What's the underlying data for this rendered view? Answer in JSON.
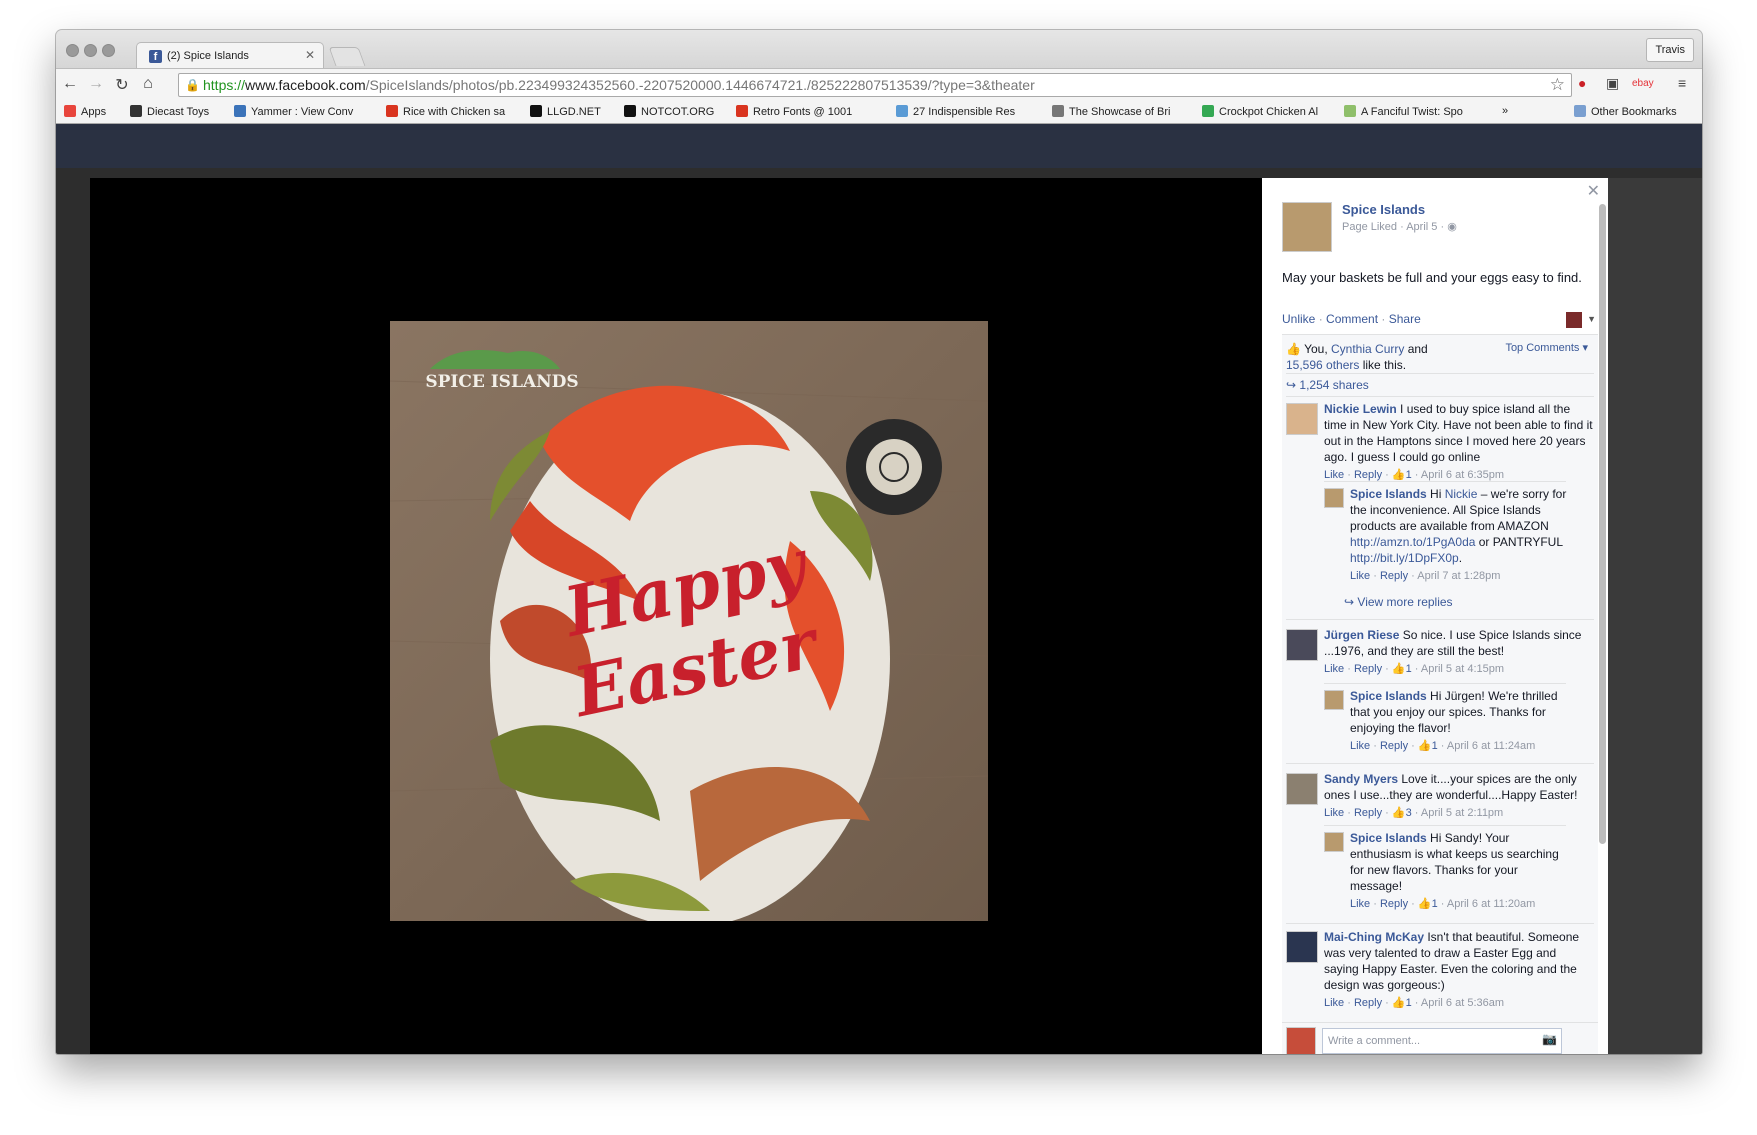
{
  "browser": {
    "tab_title": "(2) Spice Islands",
    "user_button": "Travis",
    "url_https": "https://",
    "url_host": "www.facebook.com",
    "url_path": "/SpiceIslands/photos/pb.223499324352560.-2207520000.1446674721./825222807513539/?type=3&theater",
    "bookmarks": [
      {
        "label": "Apps",
        "color": "#e8453c"
      },
      {
        "label": "Diecast Toys",
        "color": "#333333"
      },
      {
        "label": "Yammer : View Conv",
        "color": "#3b73b9"
      },
      {
        "label": "Rice with Chicken sa",
        "color": "#d9341f"
      },
      {
        "label": "LLGD.NET",
        "color": "#111111"
      },
      {
        "label": "NOTCOT.ORG",
        "color": "#111111"
      },
      {
        "label": "Retro Fonts @ 1001",
        "color": "#d9341f"
      },
      {
        "label": "27 Indispensible Res",
        "color": "#5a9bd5"
      },
      {
        "label": "The Showcase of Bri",
        "color": "#777777"
      },
      {
        "label": "Crockpot Chicken Al",
        "color": "#34a853"
      },
      {
        "label": "A Fanciful Twist: Spo",
        "color": "#8fbf6a"
      }
    ],
    "bookmarks_more": "»",
    "other_bookmarks": "Other Bookmarks"
  },
  "post": {
    "page_name": "Spice Islands",
    "meta": "Page Liked · April 5 ·",
    "text": "May your baskets be full and your eggs easy to find.",
    "actions": [
      "Unlike",
      "Comment",
      "Share"
    ],
    "likes_prefix": "You, ",
    "likes_name": "Cynthia Curry",
    "likes_and": " and",
    "likes_others": "15,596 others",
    "likes_suffix": " like this.",
    "top_comments": "Top Comments",
    "shares": "1,254 shares",
    "write_placeholder": "Write a comment..."
  },
  "comments": [
    {
      "name": "Nickie Lewin",
      "text": " I used to buy spice island all the time in New York City. Have not been able to find it out in the Hamptons since I moved here 20 years ago. I guess I could go online",
      "likes": "1",
      "time": "April 6 at 6:35pm",
      "avatar_color": "#d9b38c",
      "reply": {
        "name": "Spice Islands",
        "pre": " Hi ",
        "mention": "Nickie",
        "text": " – we're sorry for the inconvenience. All Spice Islands products are available from AMAZON ",
        "link1": "http://amzn.to/1PgA0da",
        "mid": " or PANTRYFUL ",
        "link2": "http://bit.ly/1DpFX0p",
        "end": ".",
        "time": "April 7 at 1:28pm"
      },
      "view_more": "View more replies"
    },
    {
      "name": "Jürgen Riese",
      "text": " So nice. I use Spice Islands since ...1976, and they are still the best!",
      "likes": "1",
      "time": "April 5 at 4:15pm",
      "avatar_color": "#4a4a5a",
      "reply": {
        "name": "Spice Islands",
        "text": " Hi Jürgen! We're thrilled that you enjoy our spices. Thanks for enjoying the flavor!",
        "likes": "1",
        "time": "April 6 at 11:24am"
      }
    },
    {
      "name": "Sandy Myers",
      "text": " Love it....your spices are the only ones I use...they are wonderful....Happy Easter!",
      "likes": "3",
      "time": "April 5 at 2:11pm",
      "avatar_color": "#8b8070",
      "reply": {
        "name": "Spice Islands",
        "text": " Hi Sandy! Your enthusiasm is what keeps us searching for new flavors. Thanks for your message!",
        "likes": "1",
        "time": "April 6 at 11:20am"
      }
    },
    {
      "name": "Mai-Ching McKay",
      "text": " Isn't that beautiful. Someone was very talented to draw a Easter Egg and saying Happy Easter. Even the coloring and the design was gorgeous:)",
      "likes": "1",
      "time": "April 6 at 5:36am",
      "avatar_color": "#2a3550"
    }
  ],
  "labels": {
    "like": "Like",
    "reply": "Reply"
  },
  "image": {
    "brand": "SPICE ISLANDS",
    "line1": "Happy",
    "line2": "Easter",
    "tin_text": "SPICE ISLANDS"
  }
}
